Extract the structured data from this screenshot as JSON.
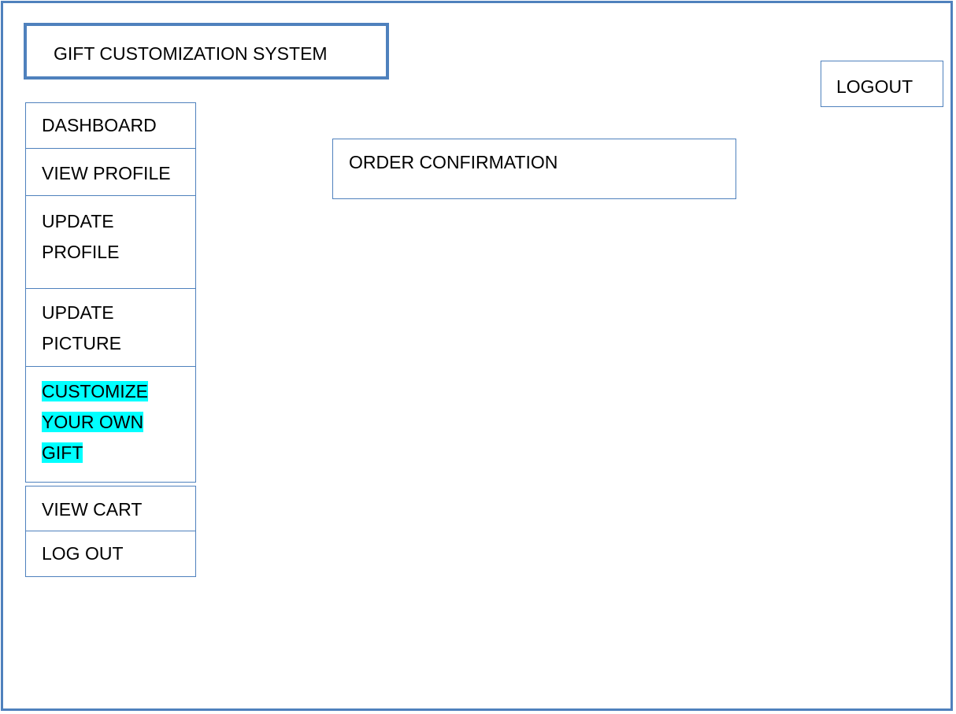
{
  "app": {
    "title": "GIFT CUSTOMIZATION SYSTEM"
  },
  "header": {
    "logout_label": "LOGOUT"
  },
  "sidebar": {
    "items": [
      {
        "label": "DASHBOARD"
      },
      {
        "label": "VIEW PROFILE"
      },
      {
        "label": "UPDATE PROFILE"
      },
      {
        "label": "UPDATE PICTURE"
      },
      {
        "label": "CUSTOMIZE YOUR OWN GIFT",
        "highlighted": true
      },
      {
        "label": "VIEW CART"
      },
      {
        "label": "LOG OUT"
      }
    ]
  },
  "main": {
    "section_title": "ORDER CONFIRMATION"
  },
  "colors": {
    "border": "#4f81bd",
    "highlight": "#00ffff",
    "background": "#ffffff"
  }
}
